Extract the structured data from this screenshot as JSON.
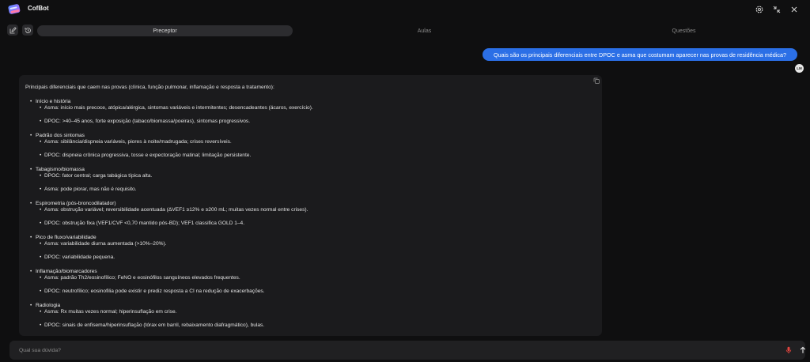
{
  "app": {
    "title": "CofBot"
  },
  "tabs": [
    {
      "label": "Preceptor",
      "active": true
    },
    {
      "label": "Aulas",
      "active": false
    },
    {
      "label": "Questões",
      "active": false
    }
  ],
  "user_message": {
    "text": "Quais são os principais diferenciais entre DPOC e asma que costumam aparecer nas provas de residência médica?",
    "avatar": "LM"
  },
  "bot_message": {
    "intro": "Principais diferenciais que caem nas provas (clínica, função pulmonar, inflamação e resposta a tratamento):",
    "sections": [
      {
        "title": "Início e história",
        "items": [
          "Asma: início mais precoce, atópica/alérgica, sintomas variáveis e intermitentes; desencadeantes (ácaros, exercício).",
          "DPOC: >40–45 anos, forte exposição (tabaco/biomassa/poeiras), sintomas progressivos."
        ]
      },
      {
        "title": "Padrão dos sintomas",
        "items": [
          "Asma: sibilância/dispneia variáveis, piores à noite/madrugada; crises reversíveis.",
          "DPOC: dispneia crônica progressiva, tosse e expectoração matinal; limitação persistente."
        ]
      },
      {
        "title": "Tabagismo/biomassa",
        "items": [
          "DPOC: fator central; carga tabágica típica alta.",
          "Asma: pode piorar, mas não é requisito."
        ]
      },
      {
        "title": "Espirometria (pós-broncodilatador)",
        "items": [
          "Asma: obstrução variável; reversibilidade acentuada (ΔVEF1 ≥12% e ≥200 mL; muitas vezes normal entre crises).",
          "DPOC: obstrução fixa (VEF1/CVF <0,70 mantido pós-BD); VEF1 classifica GOLD 1–4."
        ]
      },
      {
        "title": "Pico de fluxo/variabilidade",
        "items": [
          "Asma: variabilidade diurna aumentada (>10%–20%).",
          "DPOC: variabilidade pequena."
        ]
      },
      {
        "title": "Inflamação/biomarcadores",
        "items": [
          "Asma: padrão Th2/eosinofílico; FeNO e eosinófilos sanguíneos elevados frequentes.",
          "DPOC: neutrofílico; eosinofilia pode existir e prediz resposta a CI na redução de exacerbações."
        ]
      },
      {
        "title": "Radiologia",
        "items": [
          "Asma: Rx muitas vezes normal; hiperinsuflação em crise.",
          "DPOC: sinais de enfisema/hiperinsuflação (tórax em barril, rebaixamento diafragmático), bulas."
        ]
      }
    ]
  },
  "input": {
    "placeholder": "Qual sua dúvida?"
  },
  "icons": {
    "logo": "cofbot-logo-icon",
    "settings": "gear-icon",
    "minimize": "collapse-icon",
    "close": "close-icon",
    "new_chat": "edit-icon",
    "history": "history-icon",
    "copy": "copy-icon",
    "mic": "mic-icon",
    "send": "arrow-up-icon"
  },
  "colors": {
    "accent": "#2b6fe6",
    "mic": "#e0443e",
    "background": "#0f0f10",
    "panel": "#1b1b1d"
  }
}
